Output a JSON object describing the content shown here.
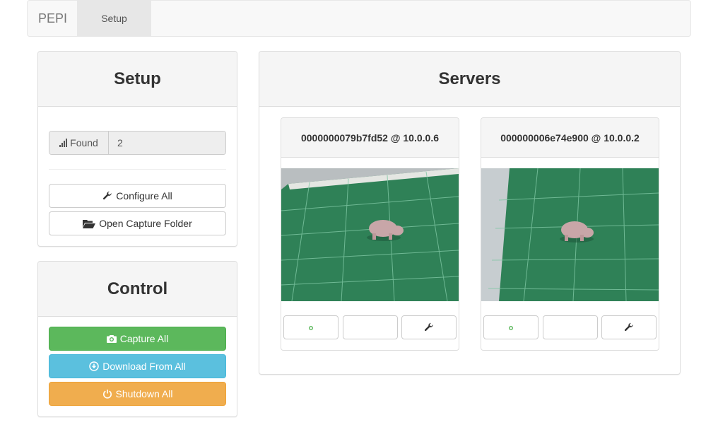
{
  "navbar": {
    "brand": "PEPI",
    "tabs": [
      {
        "label": "Setup",
        "active": true
      }
    ]
  },
  "setup": {
    "title": "Setup",
    "found_label": "Found",
    "found_value": "2",
    "configure_label": "Configure All",
    "open_folder_label": "Open Capture Folder"
  },
  "control": {
    "title": "Control",
    "capture_label": "Capture All",
    "download_label": "Download From All",
    "shutdown_label": "Shutdown All"
  },
  "servers": {
    "title": "Servers",
    "items": [
      {
        "name": "0000000079b7fd52 @ 10.0.0.6",
        "preview_icon": "rhino-figurine-on-cutting-mat"
      },
      {
        "name": "000000006e74e900 @ 10.0.0.2",
        "preview_icon": "rhino-figurine-on-cutting-mat"
      }
    ]
  },
  "colors": {
    "success": "#5cb85c",
    "info": "#5bc0de",
    "warning": "#f0ad4e",
    "danger": "#d9534f",
    "panel_heading": "#f5f5f5"
  },
  "icons": {
    "found": "signal-icon",
    "configure": "wrench-icon",
    "open_folder": "folder-open-icon",
    "capture": "camera-icon",
    "download": "download-icon",
    "shutdown": "power-icon",
    "server_capture": "camera-icon",
    "server_stream": "video-camera-icon",
    "server_settings": "wrench-icon"
  }
}
